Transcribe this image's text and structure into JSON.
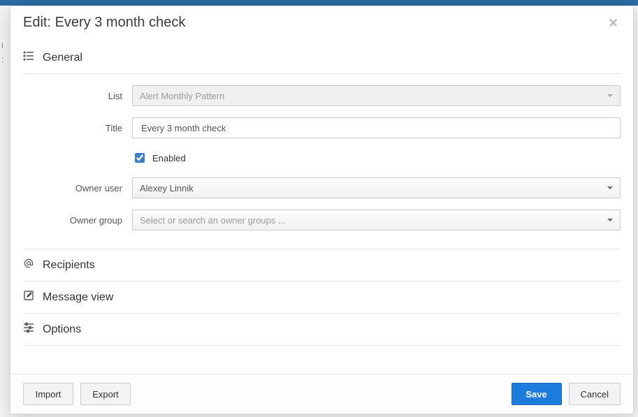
{
  "modal": {
    "title": "Edit: Every 3 month check",
    "sections": {
      "general": {
        "label": "General",
        "fields": {
          "list_label": "List",
          "list_value": "Alert Monthly Pattern",
          "title_label": "Title",
          "title_value": "Every 3 month check",
          "enabled_label": "Enabled",
          "enabled_checked": true,
          "owner_user_label": "Owner user",
          "owner_user_value": "Alexey Linnik",
          "owner_group_label": "Owner group",
          "owner_group_placeholder": "Select or search an owner groups ..."
        }
      },
      "recipients": {
        "label": "Recipients"
      },
      "message_view": {
        "label": "Message view"
      },
      "options": {
        "label": "Options"
      }
    }
  },
  "footer": {
    "import": "Import",
    "export": "Export",
    "save": "Save",
    "cancel": "Cancel"
  },
  "bg": {
    "line1": "i",
    "line2": ":"
  }
}
